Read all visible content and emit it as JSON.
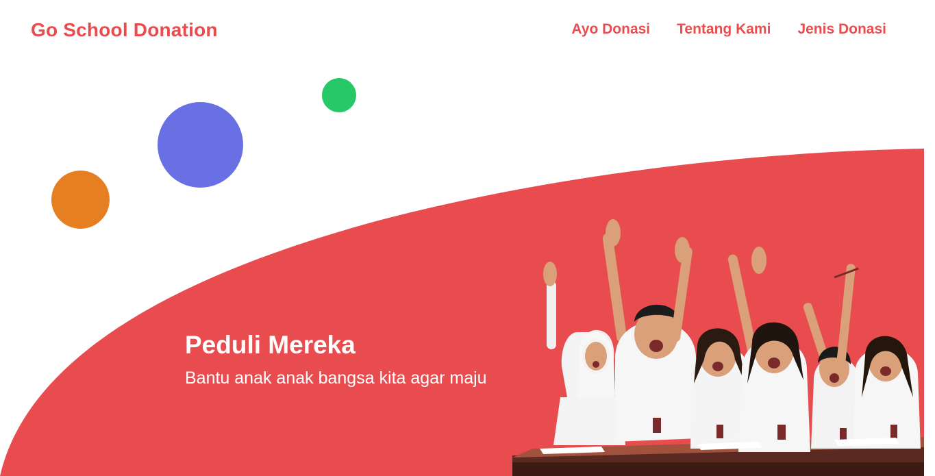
{
  "header": {
    "logo": "Go School Donation",
    "nav": [
      {
        "label": "Ayo Donasi"
      },
      {
        "label": "Tentang Kami"
      },
      {
        "label": "Jenis Donasi"
      }
    ]
  },
  "hero": {
    "title": "Peduli Mereka",
    "subtitle": "Bantu anak anak bangsa kita agar maju"
  },
  "colors": {
    "brand_red": "#e84c4f",
    "circle_green": "#27c868",
    "circle_blue": "#6970e3",
    "circle_orange": "#e67e22"
  },
  "icons": {
    "scroll_up": "▲",
    "scroll_down": "▼"
  }
}
